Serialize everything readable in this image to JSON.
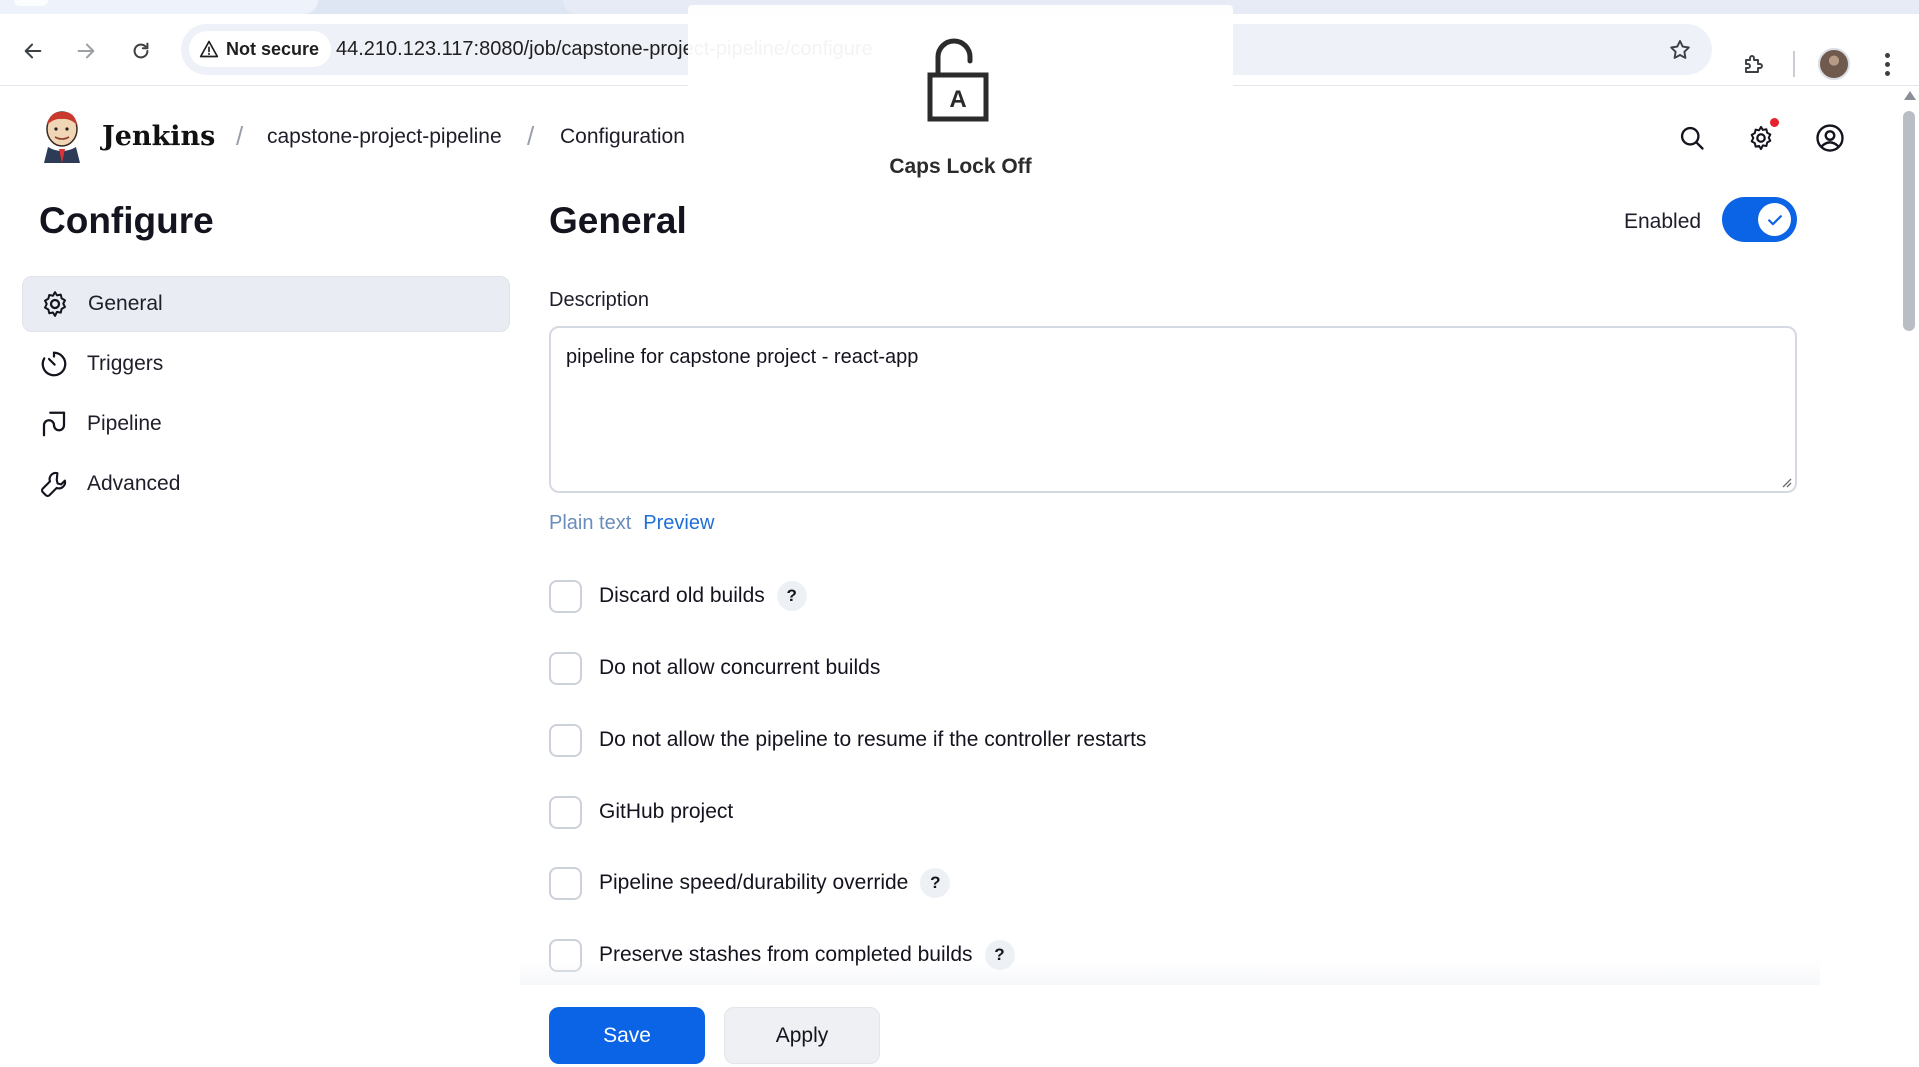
{
  "browser": {
    "security_label": "Not secure",
    "url": "44.210.123.117:8080/job/capstone-project-pipeline/configure"
  },
  "overlay": {
    "caps_label": "Caps Lock Off",
    "key_letter": "A"
  },
  "header": {
    "brand": "Jenkins",
    "breadcrumbs": [
      "capstone-project-pipeline",
      "Configuration"
    ],
    "notification_color": "#e5232e"
  },
  "sidebar": {
    "title": "Configure",
    "items": [
      {
        "label": "General",
        "icon": "gear-icon",
        "active": true
      },
      {
        "label": "Triggers",
        "icon": "clock-icon",
        "active": false
      },
      {
        "label": "Pipeline",
        "icon": "pipeline-icon",
        "active": false
      },
      {
        "label": "Advanced",
        "icon": "wrench-icon",
        "active": false
      }
    ]
  },
  "main": {
    "title": "General",
    "enabled_label": "Enabled",
    "enabled": true,
    "description_label": "Description",
    "description_value": "pipeline for capstone project - react-app",
    "format_plain": "Plain text",
    "format_preview": "Preview",
    "options": [
      {
        "label": "Discard old builds",
        "checked": false,
        "help": true
      },
      {
        "label": "Do not allow concurrent builds",
        "checked": false,
        "help": false
      },
      {
        "label": "Do not allow the pipeline to resume if the controller restarts",
        "checked": false,
        "help": false
      },
      {
        "label": "GitHub project",
        "checked": false,
        "help": false
      },
      {
        "label": "Pipeline speed/durability override",
        "checked": false,
        "help": true
      },
      {
        "label": "Preserve stashes from completed builds",
        "checked": false,
        "help": true
      }
    ],
    "help_glyph": "?"
  },
  "footer": {
    "save_label": "Save",
    "apply_label": "Apply"
  },
  "colors": {
    "accent": "#0b63e5",
    "link": "#1f6fd8"
  }
}
